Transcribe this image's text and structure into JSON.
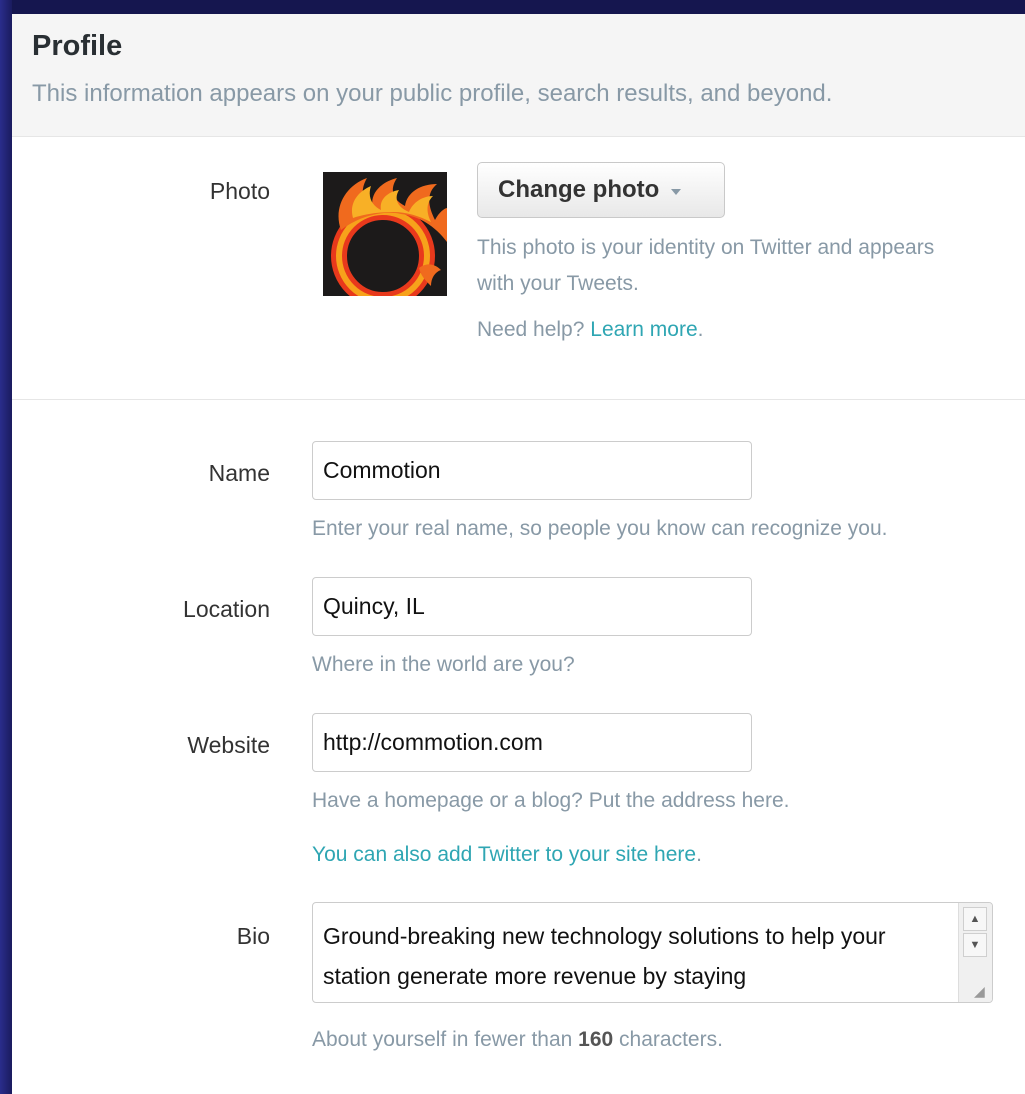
{
  "header": {
    "title": "Profile",
    "subtitle": "This information appears on your public profile, search results, and beyond."
  },
  "photo": {
    "label": "Photo",
    "change_button_label": "Change photo",
    "help_text": "This photo is your identity on Twitter and appears",
    "help_text_2": "with your Tweets.",
    "need_help_prefix": "Need help? ",
    "learn_more_link": "Learn more",
    "learn_more_suffix": "."
  },
  "name": {
    "label": "Name",
    "value": "Commotion",
    "help": "Enter your real name, so people you know can recognize you."
  },
  "location": {
    "label": "Location",
    "value": "Quincy, IL",
    "help": "Where in the world are you?"
  },
  "website": {
    "label": "Website",
    "value": "http://commotion.com",
    "help": "Have a homepage or a blog? Put the address here.",
    "add_twitter_link": "You can also add Twitter to your site here",
    "add_twitter_suffix": "."
  },
  "bio": {
    "label": "Bio",
    "value": "Ground-breaking new technology solutions to help your station generate more revenue by staying",
    "help_prefix": "About yourself in fewer than ",
    "help_limit": "160",
    "help_suffix": " characters."
  },
  "colors": {
    "link": "#2fa6b3",
    "muted": "#8899a6",
    "frame": "#1e1f6b"
  }
}
